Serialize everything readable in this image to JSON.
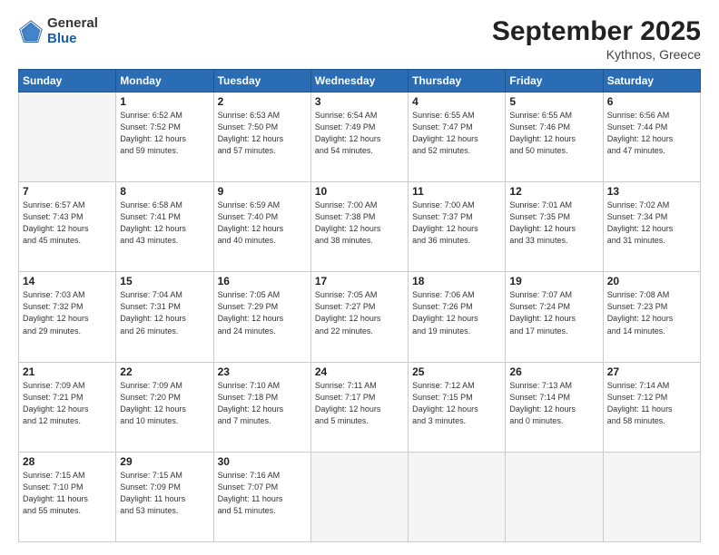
{
  "header": {
    "logo_general": "General",
    "logo_blue": "Blue",
    "title": "September 2025",
    "subtitle": "Kythnos, Greece"
  },
  "weekdays": [
    "Sunday",
    "Monday",
    "Tuesday",
    "Wednesday",
    "Thursday",
    "Friday",
    "Saturday"
  ],
  "weeks": [
    [
      {
        "day": "",
        "info": ""
      },
      {
        "day": "1",
        "info": "Sunrise: 6:52 AM\nSunset: 7:52 PM\nDaylight: 12 hours\nand 59 minutes."
      },
      {
        "day": "2",
        "info": "Sunrise: 6:53 AM\nSunset: 7:50 PM\nDaylight: 12 hours\nand 57 minutes."
      },
      {
        "day": "3",
        "info": "Sunrise: 6:54 AM\nSunset: 7:49 PM\nDaylight: 12 hours\nand 54 minutes."
      },
      {
        "day": "4",
        "info": "Sunrise: 6:55 AM\nSunset: 7:47 PM\nDaylight: 12 hours\nand 52 minutes."
      },
      {
        "day": "5",
        "info": "Sunrise: 6:55 AM\nSunset: 7:46 PM\nDaylight: 12 hours\nand 50 minutes."
      },
      {
        "day": "6",
        "info": "Sunrise: 6:56 AM\nSunset: 7:44 PM\nDaylight: 12 hours\nand 47 minutes."
      }
    ],
    [
      {
        "day": "7",
        "info": "Sunrise: 6:57 AM\nSunset: 7:43 PM\nDaylight: 12 hours\nand 45 minutes."
      },
      {
        "day": "8",
        "info": "Sunrise: 6:58 AM\nSunset: 7:41 PM\nDaylight: 12 hours\nand 43 minutes."
      },
      {
        "day": "9",
        "info": "Sunrise: 6:59 AM\nSunset: 7:40 PM\nDaylight: 12 hours\nand 40 minutes."
      },
      {
        "day": "10",
        "info": "Sunrise: 7:00 AM\nSunset: 7:38 PM\nDaylight: 12 hours\nand 38 minutes."
      },
      {
        "day": "11",
        "info": "Sunrise: 7:00 AM\nSunset: 7:37 PM\nDaylight: 12 hours\nand 36 minutes."
      },
      {
        "day": "12",
        "info": "Sunrise: 7:01 AM\nSunset: 7:35 PM\nDaylight: 12 hours\nand 33 minutes."
      },
      {
        "day": "13",
        "info": "Sunrise: 7:02 AM\nSunset: 7:34 PM\nDaylight: 12 hours\nand 31 minutes."
      }
    ],
    [
      {
        "day": "14",
        "info": "Sunrise: 7:03 AM\nSunset: 7:32 PM\nDaylight: 12 hours\nand 29 minutes."
      },
      {
        "day": "15",
        "info": "Sunrise: 7:04 AM\nSunset: 7:31 PM\nDaylight: 12 hours\nand 26 minutes."
      },
      {
        "day": "16",
        "info": "Sunrise: 7:05 AM\nSunset: 7:29 PM\nDaylight: 12 hours\nand 24 minutes."
      },
      {
        "day": "17",
        "info": "Sunrise: 7:05 AM\nSunset: 7:27 PM\nDaylight: 12 hours\nand 22 minutes."
      },
      {
        "day": "18",
        "info": "Sunrise: 7:06 AM\nSunset: 7:26 PM\nDaylight: 12 hours\nand 19 minutes."
      },
      {
        "day": "19",
        "info": "Sunrise: 7:07 AM\nSunset: 7:24 PM\nDaylight: 12 hours\nand 17 minutes."
      },
      {
        "day": "20",
        "info": "Sunrise: 7:08 AM\nSunset: 7:23 PM\nDaylight: 12 hours\nand 14 minutes."
      }
    ],
    [
      {
        "day": "21",
        "info": "Sunrise: 7:09 AM\nSunset: 7:21 PM\nDaylight: 12 hours\nand 12 minutes."
      },
      {
        "day": "22",
        "info": "Sunrise: 7:09 AM\nSunset: 7:20 PM\nDaylight: 12 hours\nand 10 minutes."
      },
      {
        "day": "23",
        "info": "Sunrise: 7:10 AM\nSunset: 7:18 PM\nDaylight: 12 hours\nand 7 minutes."
      },
      {
        "day": "24",
        "info": "Sunrise: 7:11 AM\nSunset: 7:17 PM\nDaylight: 12 hours\nand 5 minutes."
      },
      {
        "day": "25",
        "info": "Sunrise: 7:12 AM\nSunset: 7:15 PM\nDaylight: 12 hours\nand 3 minutes."
      },
      {
        "day": "26",
        "info": "Sunrise: 7:13 AM\nSunset: 7:14 PM\nDaylight: 12 hours\nand 0 minutes."
      },
      {
        "day": "27",
        "info": "Sunrise: 7:14 AM\nSunset: 7:12 PM\nDaylight: 11 hours\nand 58 minutes."
      }
    ],
    [
      {
        "day": "28",
        "info": "Sunrise: 7:15 AM\nSunset: 7:10 PM\nDaylight: 11 hours\nand 55 minutes."
      },
      {
        "day": "29",
        "info": "Sunrise: 7:15 AM\nSunset: 7:09 PM\nDaylight: 11 hours\nand 53 minutes."
      },
      {
        "day": "30",
        "info": "Sunrise: 7:16 AM\nSunset: 7:07 PM\nDaylight: 11 hours\nand 51 minutes."
      },
      {
        "day": "",
        "info": ""
      },
      {
        "day": "",
        "info": ""
      },
      {
        "day": "",
        "info": ""
      },
      {
        "day": "",
        "info": ""
      }
    ]
  ]
}
